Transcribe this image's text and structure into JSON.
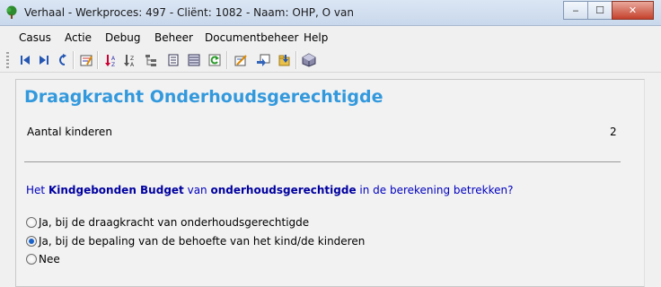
{
  "window": {
    "title": "Verhaal - Werkproces: 497 - Cliënt: 1082 - Naam: OHP, O van",
    "controls": {
      "minimize": "‒",
      "maximize": "☐",
      "close": "✕"
    }
  },
  "menu": [
    "Casus",
    "Actie",
    "Debug",
    "Beheer",
    "Documentbeheer",
    "Help"
  ],
  "toolbar": {
    "icons": [
      "first-record-icon",
      "last-record-icon",
      "refresh-arrow-icon",
      "edit-form-icon",
      "sort-az-icon",
      "sort-za-icon",
      "tree-structure-icon",
      "document-icon",
      "list-icon",
      "reload-icon",
      "note-edit-icon",
      "note-send-icon",
      "folder-arrow-icon",
      "package-icon"
    ]
  },
  "page": {
    "heading": "Draagkracht Onderhoudsgerechtigde",
    "field": {
      "label": "Aantal kinderen",
      "value": "2"
    },
    "question": {
      "prefix": "Het ",
      "strong1": "Kindgebonden Budget",
      "middle": " van ",
      "strong2": "onderhoudsgerechtigde",
      "suffix": " in de berekening betrekken?"
    },
    "options": [
      {
        "label": "Ja, bij de draagkracht van onderhoudsgerechtigde",
        "selected": false
      },
      {
        "label": "Ja, bij de bepaling van de behoefte van het kind/de kinderen",
        "selected": true
      },
      {
        "label": "Nee",
        "selected": false
      }
    ]
  },
  "colors": {
    "heading": "#3399dd",
    "question": "#0000c0",
    "radio_selected": "#1a63c9"
  }
}
